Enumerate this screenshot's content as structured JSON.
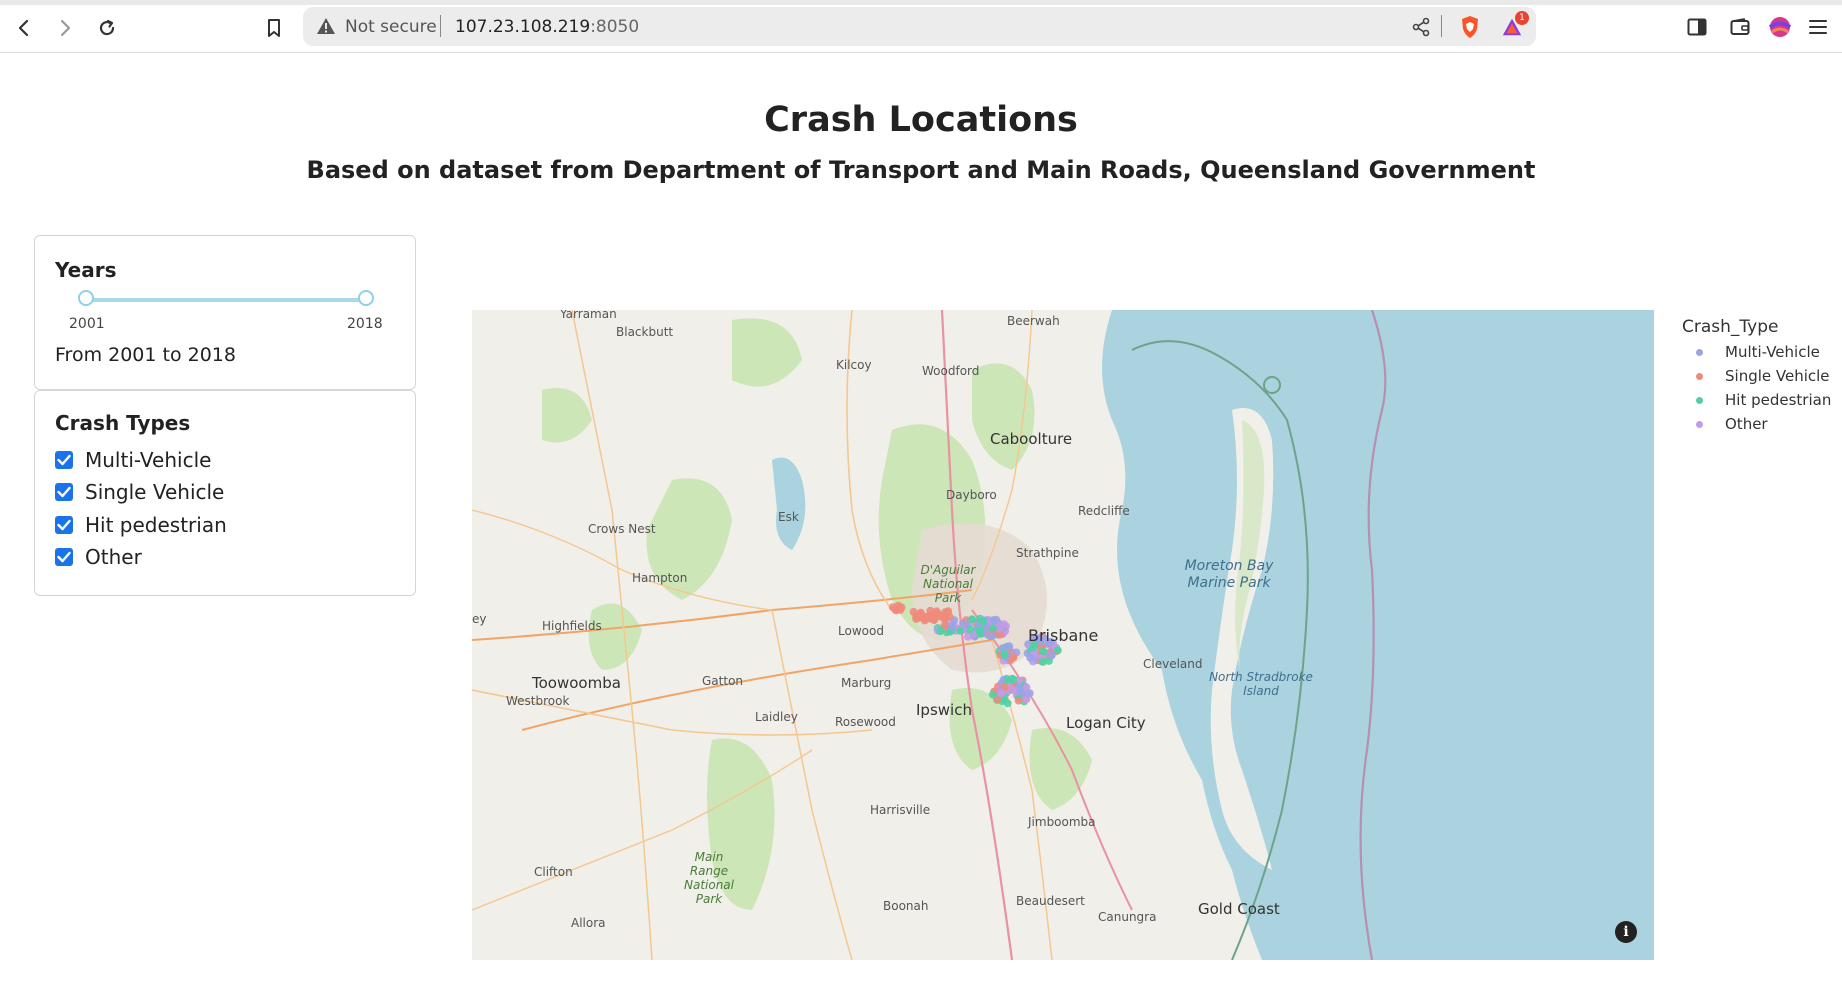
{
  "browser": {
    "security_label": "Not secure",
    "url_host": "107.23.108.219",
    "url_port": ":8050",
    "notification_count": "1"
  },
  "page": {
    "title": "Crash Locations",
    "subtitle": "Based on dataset from Department of Transport and Main Roads, Queensland Government"
  },
  "years": {
    "title": "Years",
    "min_label": "2001",
    "max_label": "2018",
    "selected_from": 2001,
    "selected_to": 2018,
    "summary": "From 2001 to 2018"
  },
  "crash_types": {
    "title": "Crash Types",
    "options": [
      {
        "label": "Multi-Vehicle",
        "checked": true
      },
      {
        "label": "Single Vehicle",
        "checked": true
      },
      {
        "label": "Hit pedestrian",
        "checked": true
      },
      {
        "label": "Other",
        "checked": true
      }
    ]
  },
  "legend": {
    "title": "Crash_Type",
    "items": [
      {
        "label": "Multi-Vehicle",
        "color": "#9aa3e8"
      },
      {
        "label": "Single Vehicle",
        "color": "#ef8a7b"
      },
      {
        "label": "Hit pedestrian",
        "color": "#4fd1a5"
      },
      {
        "label": "Other",
        "color": "#c39be8"
      }
    ]
  },
  "map": {
    "info_glyph": "i",
    "places": {
      "yarraman": "Yarraman",
      "blackbutt": "Blackbutt",
      "beerwah": "Beerwah",
      "kilcoy": "Kilcoy",
      "woodford": "Woodford",
      "caboolture": "Caboolture",
      "dayboro": "Dayboro",
      "redcliffe": "Redcliffe",
      "esk": "Esk",
      "crows_nest": "Crows Nest",
      "strathpine": "Strathpine",
      "hampton": "Hampton",
      "daguilar": "D'Aguilar National Park",
      "moreton": "Moreton Bay Marine Park",
      "highfields": "Highfields",
      "lowood": "Lowood",
      "brisbane": "Brisbane",
      "cleveland": "Cleveland",
      "north_stradbroke": "North Stradbroke Island",
      "toowoomba": "Toowoomba",
      "gatton": "Gatton",
      "marburg": "Marburg",
      "westbrook": "Westbrook",
      "laidley": "Laidley",
      "rosewood": "Rosewood",
      "ipswich": "Ipswich",
      "logan": "Logan City",
      "harrisville": "Harrisville",
      "jimboomba": "Jimboomba",
      "main_range": "Main Range National Park",
      "clifton": "Clifton",
      "boonah": "Boonah",
      "beaudesert": "Beaudesert",
      "canungra": "Canungra",
      "gold_coast": "Gold Coast",
      "allora": "Allora",
      "edge_left": "ey"
    }
  }
}
